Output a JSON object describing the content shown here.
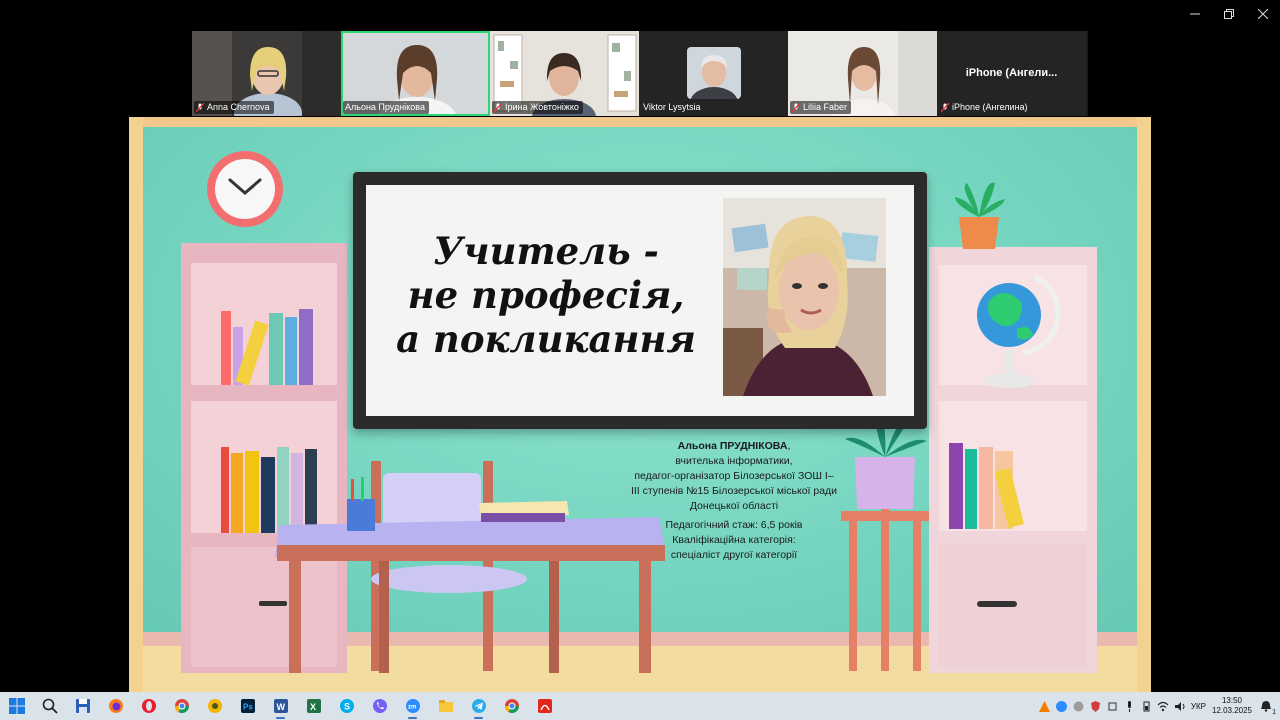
{
  "window": {
    "controls": [
      "minimize-icon",
      "restore-icon",
      "close-icon"
    ]
  },
  "participants": [
    {
      "name": "Anna Chernova",
      "muted": true,
      "active": false
    },
    {
      "name": "Альона Пруднікова",
      "muted": false,
      "active": true
    },
    {
      "name": "Ірина Жовтоніжко",
      "muted": true,
      "active": false
    },
    {
      "name": "Viktor Lysytsia",
      "muted": false,
      "active": false
    },
    {
      "name": "Liliia Faber",
      "muted": true,
      "active": false
    },
    {
      "name": "iPhone (Ангелина)",
      "display_name": "iPhone  (Ангели...",
      "muted": true,
      "active": false
    }
  ],
  "slide": {
    "title_lines": [
      "Учитель -",
      "не професія,",
      "а покликання"
    ],
    "caption": {
      "name": "Альона ПРУДНІКОВА",
      "role": "вчителька інформатики,",
      "org_lines": [
        "педагог-організатор Білозерської ЗОШ І–",
        "ІІІ ступенів №15 Білозерської міської ради",
        "Донецької області"
      ],
      "experience": "Педагогічний стаж: 6,5 років",
      "category_label": "Кваліфікаційна категорія:",
      "category_value": "спеціаліст другої категорії"
    }
  },
  "taskbar": {
    "apps": [
      "windows-start-icon",
      "search-icon",
      "save-icon",
      "firefox-icon",
      "opera-icon",
      "chrome-icon",
      "chrome-variant-icon",
      "photoshop-icon",
      "word-icon",
      "excel-icon",
      "skype-icon",
      "viber-icon",
      "zoom-icon",
      "file-explorer-icon",
      "telegram-icon",
      "chrome-icon",
      "acrobat-icon"
    ],
    "tray": {
      "language": "УКР",
      "time": "13:50",
      "date": "12.03.2025",
      "notification_count": "1"
    }
  },
  "colors": {
    "active_speaker": "#2ed573",
    "wall": "#79d6c2",
    "taskbar": "#dbe3ea"
  }
}
